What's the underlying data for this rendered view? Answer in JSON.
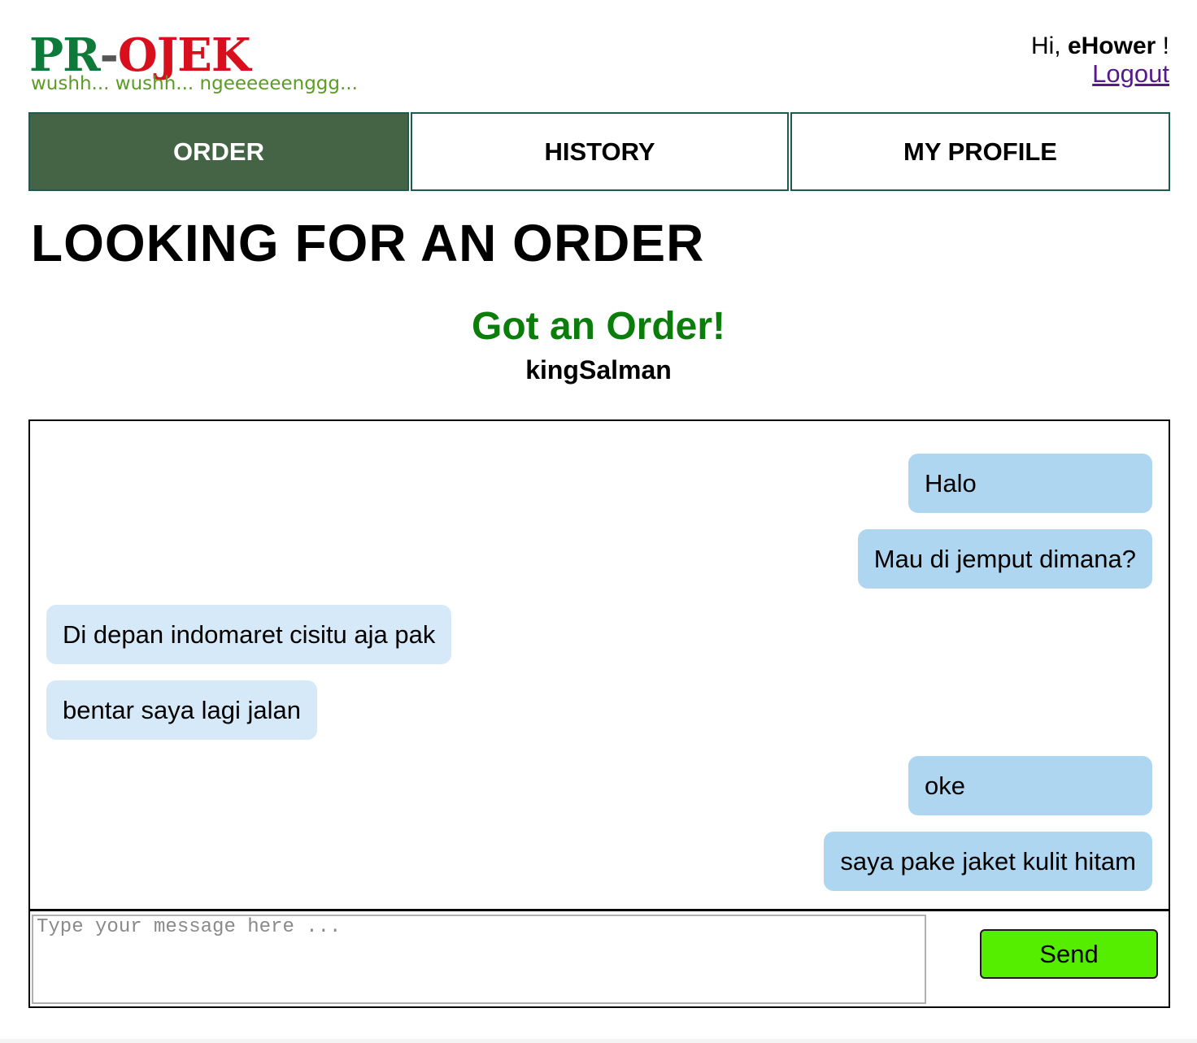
{
  "brand": {
    "logo_part1": "PR",
    "logo_dash": "-",
    "logo_part2": "OJEK",
    "tagline": "wushh... wushh... ngeeeeeenggg...",
    "colors": {
      "pr": "#0e7a3a",
      "ojek": "#d8101e",
      "tagline": "#5c9c24"
    }
  },
  "user": {
    "greeting_prefix": "Hi, ",
    "username": "eHower",
    "greeting_suffix": " !",
    "logout_label": "Logout"
  },
  "nav": {
    "tabs": [
      {
        "label": "ORDER",
        "active": true
      },
      {
        "label": "HISTORY",
        "active": false
      },
      {
        "label": "MY PROFILE",
        "active": false
      }
    ],
    "active_color": "#446445"
  },
  "main": {
    "title": "LOOKING FOR AN ORDER",
    "status": "Got an Order!",
    "customer_name": "kingSalman"
  },
  "chat": {
    "messages": [
      {
        "text": "Halo",
        "direction": "outgoing"
      },
      {
        "text": "Mau di jemput dimana?",
        "direction": "outgoing"
      },
      {
        "text": "Di depan indomaret cisitu aja pak",
        "direction": "incoming"
      },
      {
        "text": "bentar saya lagi jalan",
        "direction": "incoming"
      },
      {
        "text": "oke",
        "direction": "outgoing"
      },
      {
        "text": "saya pake jaket kulit hitam",
        "direction": "outgoing"
      }
    ],
    "outgoing_color": "#afd6f0",
    "incoming_color": "#d6e9f8"
  },
  "compose": {
    "placeholder": "Type your message here ...",
    "value": "",
    "send_label": "Send",
    "send_color": "#56ee00"
  }
}
